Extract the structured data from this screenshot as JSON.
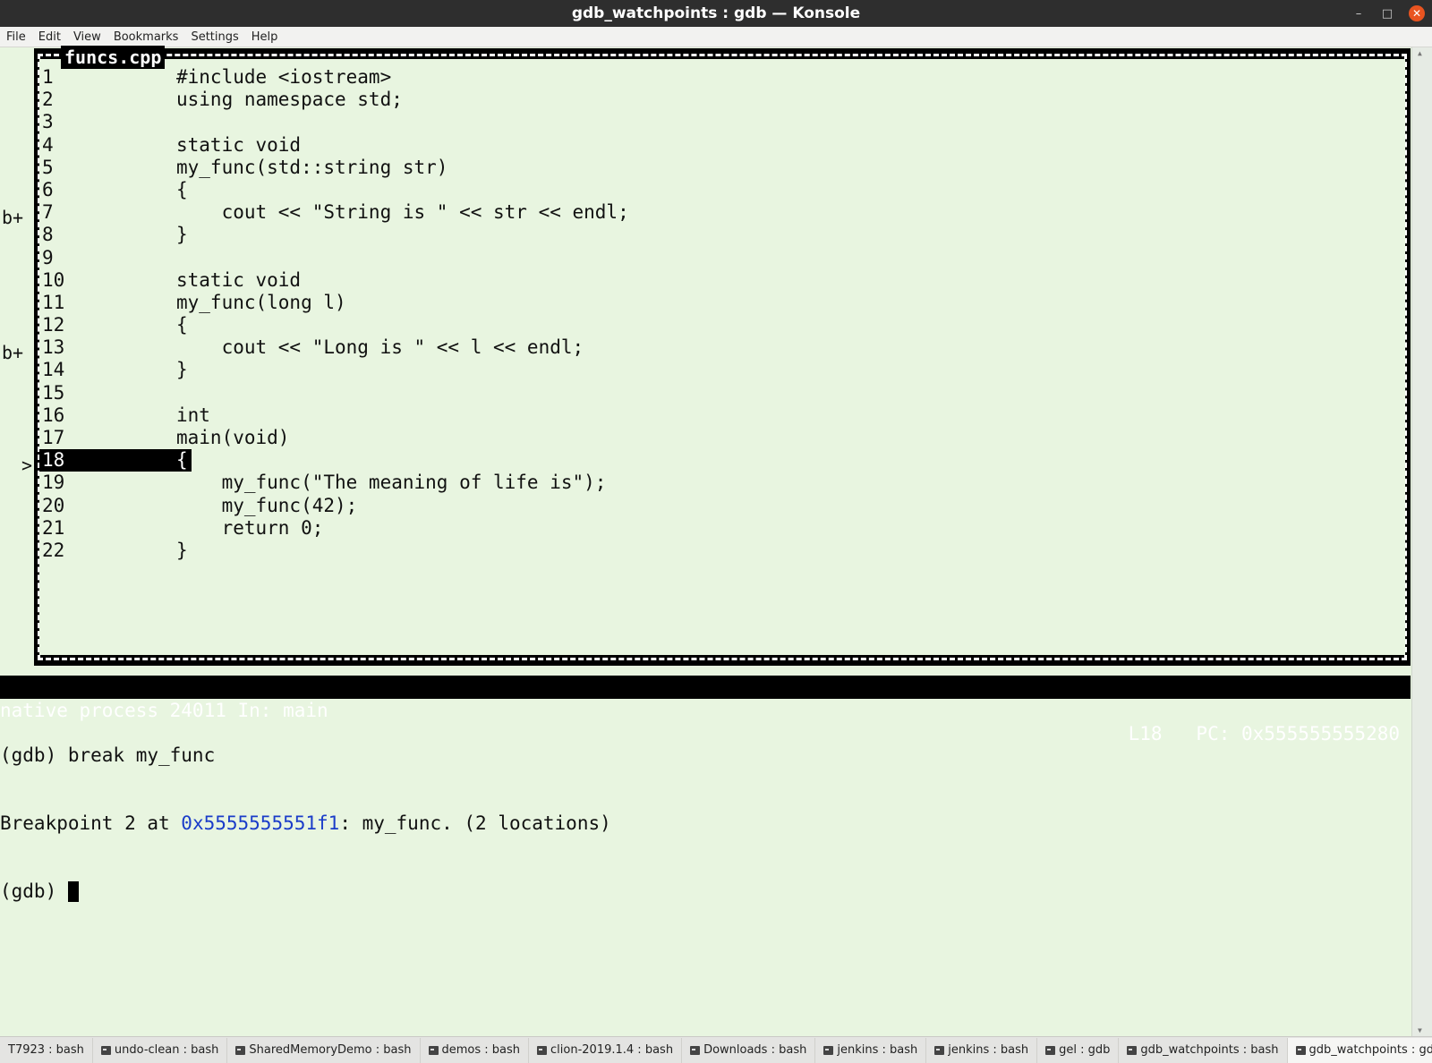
{
  "window": {
    "title": "gdb_watchpoints : gdb — Konsole",
    "minimize": "–",
    "maximize": "□",
    "close": "✕"
  },
  "menu": [
    "File",
    "Edit",
    "View",
    "Bookmarks",
    "Settings",
    "Help"
  ],
  "source": {
    "title": "funcs.cpp",
    "lines": [
      {
        "num": "1",
        "text": "#include <iostream>"
      },
      {
        "num": "2",
        "text": "using namespace std;"
      },
      {
        "num": "3",
        "text": ""
      },
      {
        "num": "4",
        "text": "static void"
      },
      {
        "num": "5",
        "text": "my_func(std::string str)"
      },
      {
        "num": "6",
        "text": "{"
      },
      {
        "num": "7",
        "text": "    cout << \"String is \" << str << endl;",
        "marker": "b+"
      },
      {
        "num": "8",
        "text": "}"
      },
      {
        "num": "9",
        "text": ""
      },
      {
        "num": "10",
        "text": "static void"
      },
      {
        "num": "11",
        "text": "my_func(long l)"
      },
      {
        "num": "12",
        "text": "{"
      },
      {
        "num": "13",
        "text": "    cout << \"Long is \" << l << endl;",
        "marker": "b+"
      },
      {
        "num": "14",
        "text": "}"
      },
      {
        "num": "15",
        "text": ""
      },
      {
        "num": "16",
        "text": "int"
      },
      {
        "num": "17",
        "text": "main(void)"
      },
      {
        "num": "18",
        "text": "{",
        "marker": ">",
        "current": true
      },
      {
        "num": "19",
        "text": "    my_func(\"The meaning of life is\");"
      },
      {
        "num": "20",
        "text": "    my_func(42);"
      },
      {
        "num": "21",
        "text": "    return 0;"
      },
      {
        "num": "22",
        "text": "}"
      }
    ]
  },
  "status": {
    "left": "native process 24011 In: main",
    "right": "L18   PC: 0x555555555280"
  },
  "console": {
    "line1": "(gdb) break my_func",
    "line2_prefix": "Breakpoint 2 at ",
    "line2_addr": "0x5555555551f1",
    "line2_suffix": ": my_func. (2 locations)",
    "prompt": "(gdb) "
  },
  "tabs": [
    {
      "label": "T7923 : bash",
      "icon": false
    },
    {
      "label": "undo-clean : bash",
      "icon": true
    },
    {
      "label": "SharedMemoryDemo : bash",
      "icon": true
    },
    {
      "label": "demos : bash",
      "icon": true
    },
    {
      "label": "clion-2019.1.4 : bash",
      "icon": true
    },
    {
      "label": "Downloads : bash",
      "icon": true
    },
    {
      "label": "jenkins : bash",
      "icon": true
    },
    {
      "label": "jenkins : bash",
      "icon": true
    },
    {
      "label": "gel : gdb",
      "icon": true
    },
    {
      "label": "gdb_watchpoints : bash",
      "icon": true
    },
    {
      "label": "gdb_watchpoints : gdb",
      "icon": true,
      "active": true
    }
  ],
  "tab_arrows": [
    "‹",
    "›"
  ],
  "scroll_arrows": [
    "▲",
    "▼"
  ]
}
